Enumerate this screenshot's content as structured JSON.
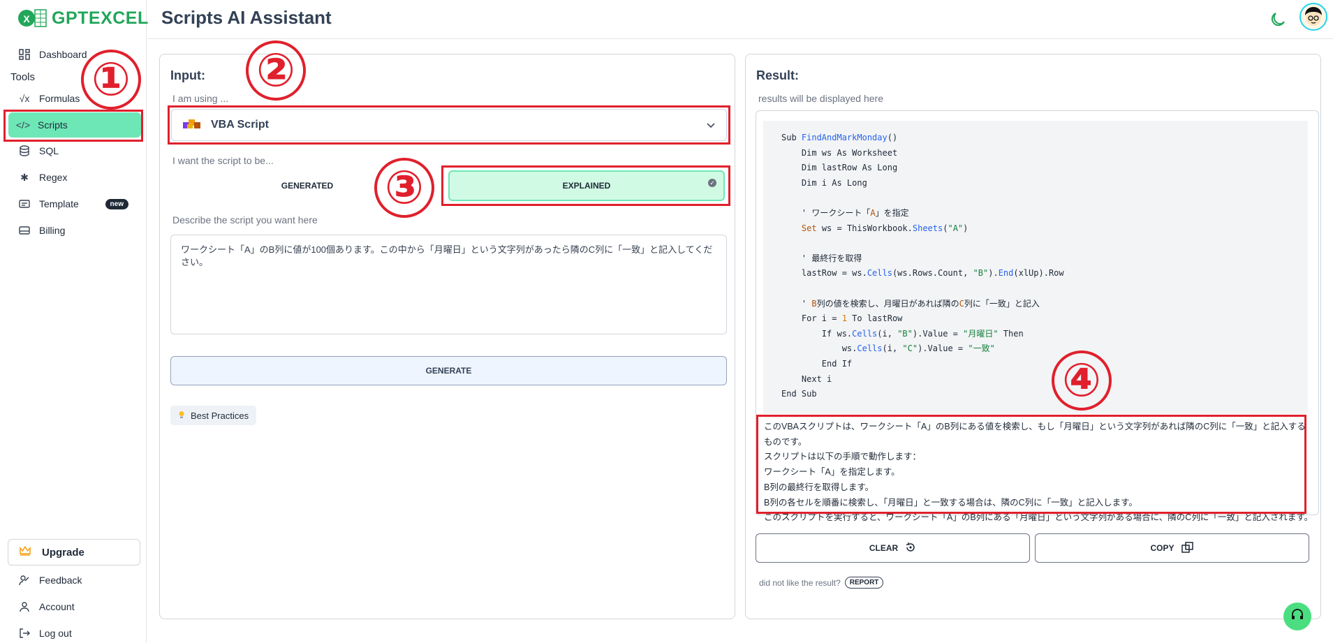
{
  "brand": {
    "name": "GPTEXCEL"
  },
  "header": {
    "title": "Scripts AI Assistant"
  },
  "sidebar": {
    "items": [
      {
        "label": "Dashboard"
      },
      {
        "label": "Formulas"
      },
      {
        "label": "Scripts"
      },
      {
        "label": "SQL"
      },
      {
        "label": "Regex"
      },
      {
        "label": "Template",
        "badge": "new"
      },
      {
        "label": "Billing"
      }
    ],
    "tools_label": "Tools",
    "upgrade_label": "Upgrade",
    "bottom": [
      {
        "label": "Feedback"
      },
      {
        "label": "Account"
      },
      {
        "label": "Log out"
      }
    ]
  },
  "annotations": {
    "n1": "①",
    "n2": "②",
    "n3": "③",
    "n4": "④"
  },
  "input": {
    "title": "Input:",
    "using_label": "I am using ...",
    "selected_tool": "VBA Script",
    "want_label": "I want the script to be...",
    "mode_generated": "GENERATED",
    "mode_explained": "EXPLAINED",
    "describe_label": "Describe the script you want here",
    "prompt": "ワークシート「A」のB列に値が100個あります。この中から「月曜日」という文字列があったら隣のC列に「一致」と記入してください。",
    "generate_label": "GENERATE",
    "best_practices": "Best Practices"
  },
  "result": {
    "title": "Result:",
    "placeholder": "results will be displayed here",
    "explanation": [
      "このVBAスクリプトは、ワークシート「A」のB列にある値を検索し、もし「月曜日」という文字列があれば隣のC列に「一致」と記入するものです。",
      "スクリプトは以下の手順で動作します：",
      "ワークシート「A」を指定します。",
      "B列の最終行を取得します。",
      "B列の各セルを順番に検索し、「月曜日」と一致する場合は、隣のC列に「一致」と記入します。",
      "このスクリプトを実行すると、ワークシート「A」のB列にある「月曜日」という文字列がある場合に、隣のC列に「一致」と記入されます。"
    ],
    "clear_label": "CLEAR",
    "copy_label": "COPY",
    "feedback_text": "did not like the result?",
    "report_label": "REPORT"
  },
  "colors": {
    "brand": "#22a65a",
    "active": "#6ee7b7",
    "annotation": "#e0202c"
  }
}
